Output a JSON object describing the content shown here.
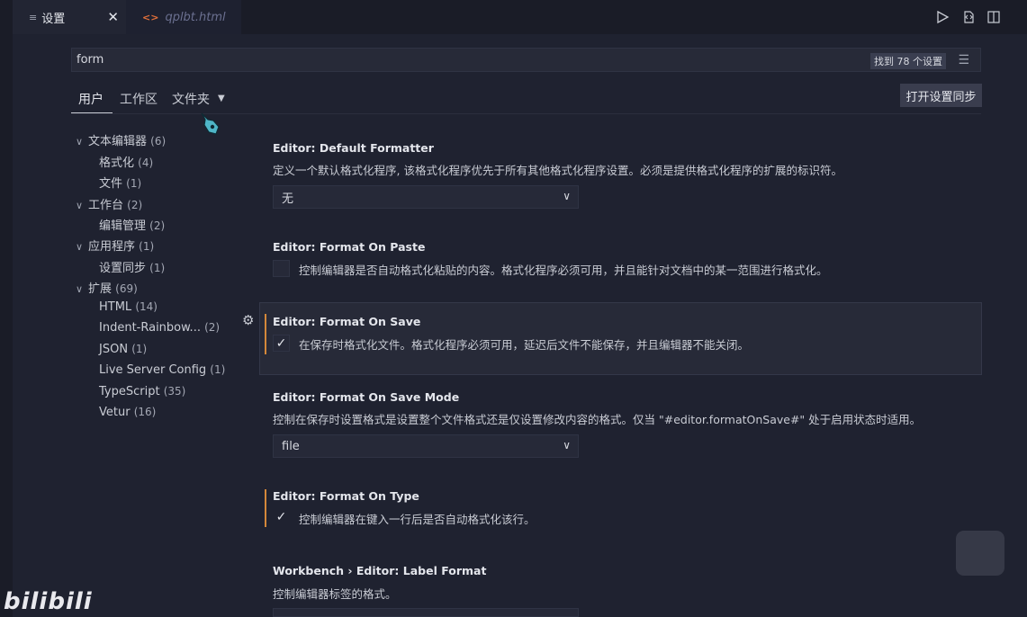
{
  "tabs": [
    {
      "icon": "settings-lines-icon",
      "label": "设置",
      "close": "✕"
    },
    {
      "icon": "html-file-icon",
      "label": "qplbt.html"
    }
  ],
  "top_icons": [
    "run-icon",
    "open-settings-json-icon",
    "split-editor-icon"
  ],
  "search": {
    "value": "form",
    "result_count": "找到 78 个设置",
    "filter_icon": "filter-icon"
  },
  "scopes": {
    "user": "用户",
    "workspace": "工作区",
    "folder": "文件夹"
  },
  "sync_button": "打开设置同步",
  "toc": [
    {
      "label": "文本编辑器",
      "count": "(6)",
      "level": 0
    },
    {
      "label": "格式化",
      "count": "(4)",
      "level": 1
    },
    {
      "label": "文件",
      "count": "(1)",
      "level": 1
    },
    {
      "label": "工作台",
      "count": "(2)",
      "level": 0
    },
    {
      "label": "编辑管理",
      "count": "(2)",
      "level": 1
    },
    {
      "label": "应用程序",
      "count": "(1)",
      "level": 0
    },
    {
      "label": "设置同步",
      "count": "(1)",
      "level": 1
    },
    {
      "label": "扩展",
      "count": "(69)",
      "level": 0
    },
    {
      "label": "HTML",
      "count": "(14)",
      "level": 1
    },
    {
      "label": "Indent-Rainbow...",
      "count": "(2)",
      "level": 1
    },
    {
      "label": "JSON",
      "count": "(1)",
      "level": 1
    },
    {
      "label": "Live Server Config",
      "count": "(1)",
      "level": 1
    },
    {
      "label": "TypeScript",
      "count": "(35)",
      "level": 1
    },
    {
      "label": "Vetur",
      "count": "(16)",
      "level": 1
    }
  ],
  "settings": {
    "default_formatter": {
      "title": "Editor: Default Formatter",
      "desc": "定义一个默认格式化程序, 该格式化程序优先于所有其他格式化程序设置。必须是提供格式化程序的扩展的标识符。",
      "value": "无"
    },
    "format_on_paste": {
      "title": "Editor: Format On Paste",
      "desc": "控制编辑器是否自动格式化粘贴的内容。格式化程序必须可用，并且能针对文档中的某一范围进行格式化。",
      "checked": false
    },
    "format_on_save": {
      "title": "Editor: Format On Save",
      "desc": "在保存时格式化文件。格式化程序必须可用，延迟后文件不能保存，并且编辑器不能关闭。",
      "checked": true
    },
    "format_on_save_mode": {
      "title": "Editor: Format On Save Mode",
      "desc": "控制在保存时设置格式是设置整个文件格式还是仅设置修改内容的格式。仅当 \"#editor.formatOnSave#\" 处于启用状态时适用。",
      "value": "file"
    },
    "format_on_type": {
      "title": "Editor: Format On Type",
      "desc": "控制编辑器在键入一行后是否自动格式化该行。",
      "checked": true
    },
    "label_format": {
      "title": "Workbench › Editor: Label Format",
      "desc": "控制编辑器标签的格式。"
    }
  },
  "watermark": "bilibili",
  "colors": {
    "modified_bar": "#d4883a",
    "background": "#1f2230",
    "tabbar": "#1a1c27"
  }
}
